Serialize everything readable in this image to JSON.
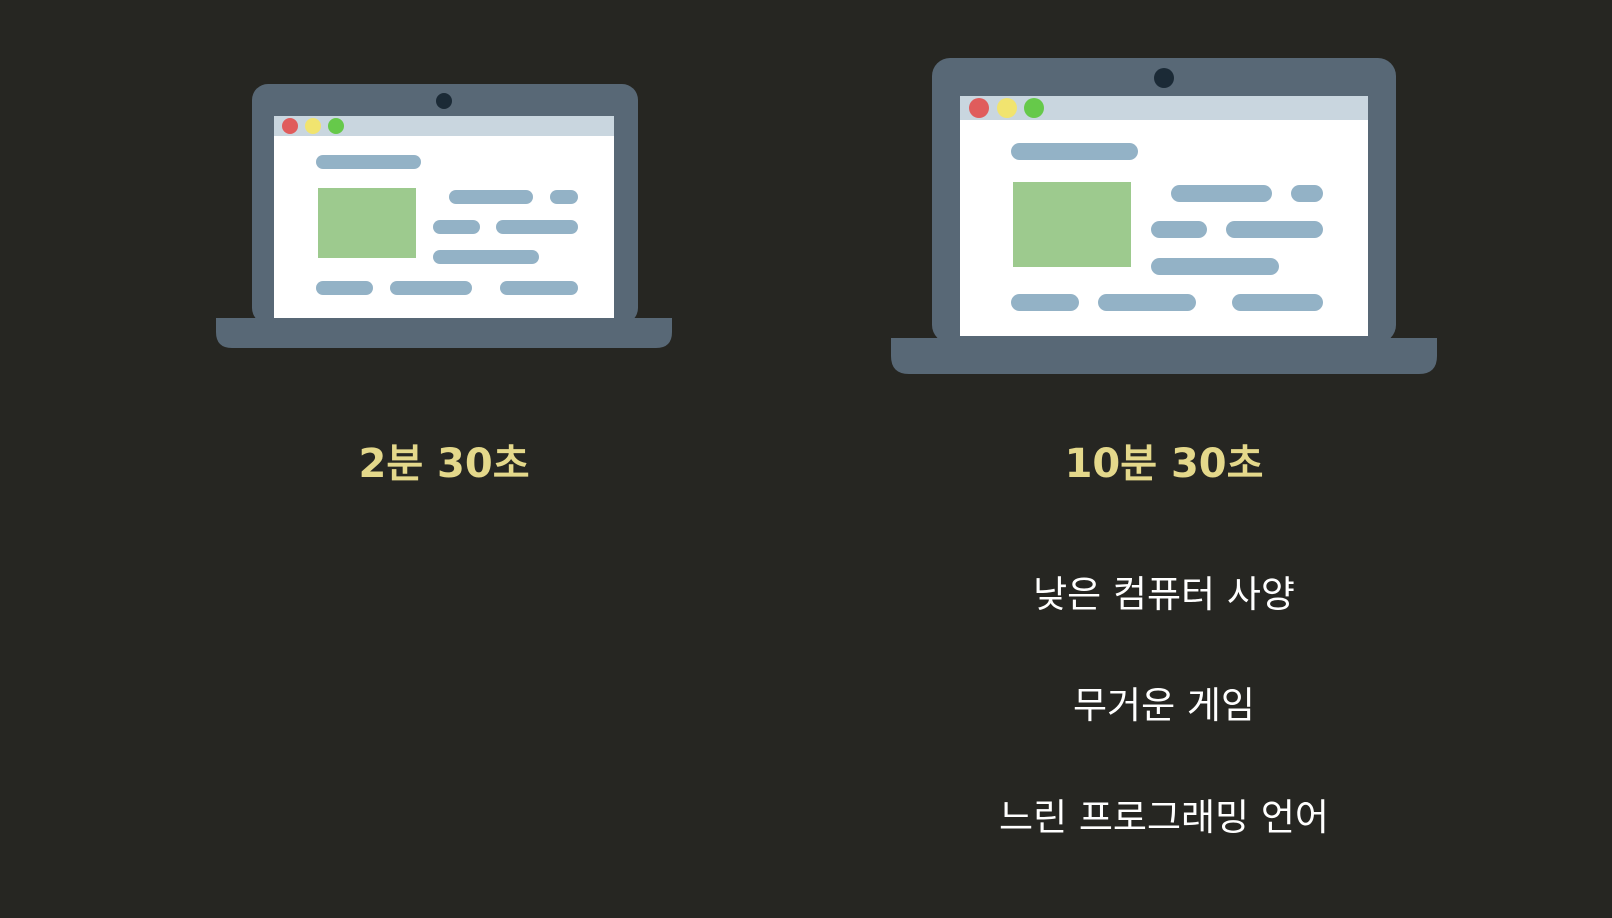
{
  "theme": {
    "background": "#262622",
    "accent": "#e4d88b",
    "text": "#ffffff",
    "laptop_body": "#586876",
    "screen_bar": "#c9d6df",
    "content_bar": "#93b2c6",
    "image_block": "#9dca8e",
    "dot_red": "#e05c5c",
    "dot_yellow": "#f1e46f",
    "dot_green": "#66c94a",
    "camera": "#1b2a36"
  },
  "left": {
    "device_icon": "laptop-icon",
    "time": "2분 30초"
  },
  "right": {
    "device_icon": "laptop-icon",
    "time": "10분 30초",
    "reasons": [
      "낮은 컴퓨터 사양",
      "무거운 게임",
      "느린 프로그래밍 언어"
    ]
  }
}
